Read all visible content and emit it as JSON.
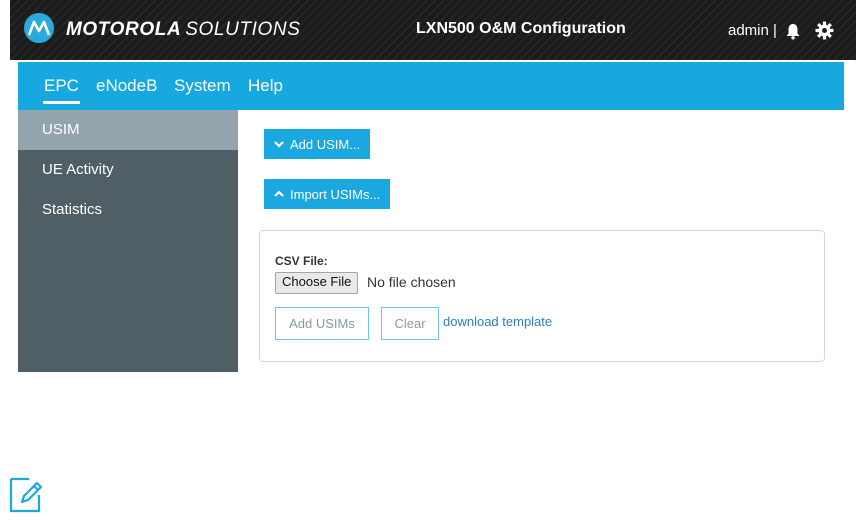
{
  "header": {
    "brand_bold": "MOTOROLA",
    "brand_light": "SOLUTIONS",
    "app_title": "LXN500 O&M Configuration",
    "user": "admin",
    "divider": "|",
    "icons": {
      "logo": "motorola-logo-icon",
      "notifications": "bell-icon",
      "settings": "gear-icon"
    }
  },
  "nav": {
    "tabs": [
      {
        "label": "EPC",
        "active": true
      },
      {
        "label": "eNodeB",
        "active": false
      },
      {
        "label": "System",
        "active": false
      },
      {
        "label": "Help",
        "active": false
      }
    ]
  },
  "sidebar": {
    "items": [
      {
        "label": "USIM",
        "active": true
      },
      {
        "label": "UE Activity",
        "active": false
      },
      {
        "label": "Statistics",
        "active": false
      }
    ]
  },
  "main": {
    "add_usim_label": "Add USIM...",
    "import_usims_label": "Import USIMs...",
    "csv_label": "CSV File:",
    "choose_file_label": "Choose File",
    "no_file_text": "No file chosen",
    "add_usims_button": "Add USIMs",
    "clear_button": "Clear",
    "download_link": "download template"
  },
  "footer": {
    "icon": "note-edit-icon"
  },
  "colors": {
    "accent": "#18a8e0",
    "sidebar": "#505f66",
    "sidebar_active": "#93a4ac",
    "topbar": "#1b1b1b",
    "link": "#2d7fbf"
  }
}
